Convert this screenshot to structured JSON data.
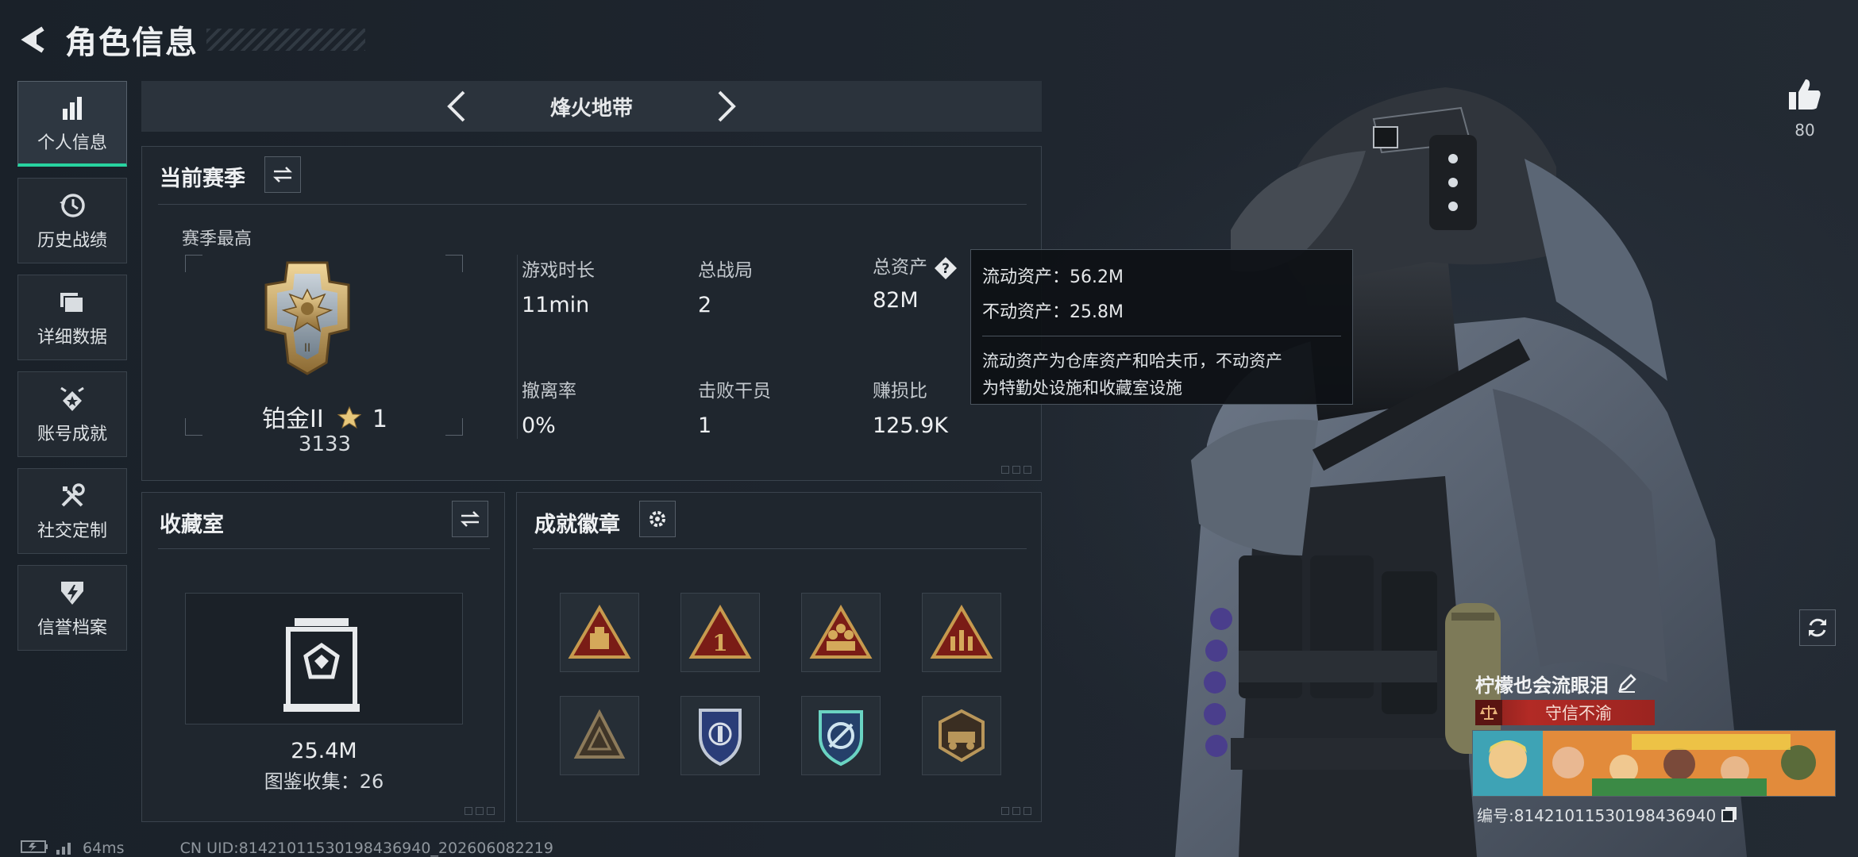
{
  "header": {
    "title": "角色信息"
  },
  "sidebar": {
    "items": [
      {
        "label": "个人信息"
      },
      {
        "label": "历史战绩"
      },
      {
        "label": "详细数据"
      },
      {
        "label": "账号成就"
      },
      {
        "label": "社交定制"
      },
      {
        "label": "信誉档案"
      }
    ]
  },
  "mode": {
    "title": "烽火地带"
  },
  "season": {
    "title": "当前赛季",
    "high_label": "赛季最高",
    "rank_name": "铂金II",
    "rank_stars": "1",
    "rank_score": "3133",
    "stats": [
      {
        "label": "游戏时长",
        "value": "11min"
      },
      {
        "label": "总战局",
        "value": "2"
      },
      {
        "label": "总资产",
        "value": "82M"
      },
      {
        "label": "撤离率",
        "value": "0%"
      },
      {
        "label": "击败干员",
        "value": "1"
      },
      {
        "label": "赚损比",
        "value": "125.9K"
      }
    ]
  },
  "tooltip": {
    "liquid": "流动资产：56.2M",
    "fixed": "不动资产：25.8M",
    "desc_1": "流动资产为仓库资产和哈夫币，不动资产",
    "desc_2": "为特勤处设施和收藏室设施"
  },
  "collection": {
    "title": "收藏室",
    "value": "25.4M",
    "count": "图鉴收集：26"
  },
  "badges": {
    "title": "成就徽章",
    "items": [
      {
        "icon": "supply-triangle-badge"
      },
      {
        "icon": "number-one-triangle-badge"
      },
      {
        "icon": "squad-triangle-badge"
      },
      {
        "icon": "ammo-triangle-badge"
      },
      {
        "icon": "faded-triangle-badge"
      },
      {
        "icon": "blue-shield-badge"
      },
      {
        "icon": "circuit-shield-badge"
      },
      {
        "icon": "vehicle-badge"
      }
    ]
  },
  "profile": {
    "likes": "80",
    "name": "柠檬也会流眼泪",
    "title_badge": "守信不渝",
    "id": "编号:814210115301984369​40"
  },
  "status": {
    "latency": "64ms",
    "uid": "CN UID:814210115301984369​40_202606082219"
  },
  "colors": {
    "accent": "#27d3a0",
    "background": "#1c232b",
    "panel": "#1f262e",
    "title_badge": "#b22a25"
  }
}
